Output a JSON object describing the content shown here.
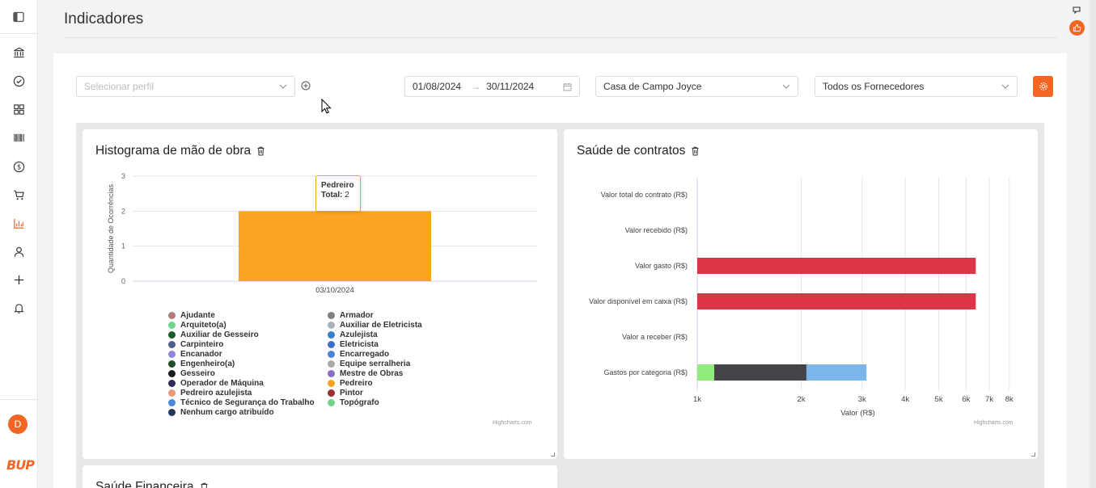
{
  "page": {
    "title": "Indicadores"
  },
  "sidebar": {
    "icons": [
      "panel-toggle-icon",
      "bank-icon",
      "check-circle-icon",
      "grid-icon",
      "barcode-icon",
      "dollar-icon",
      "cart-icon",
      "bar-chart-icon",
      "user-icon",
      "plus-icon",
      "bell-icon"
    ],
    "active": "bar-chart-icon",
    "avatar_letter": "D",
    "logo_text": "BUP"
  },
  "filters": {
    "profile_placeholder": "Selecionar perfil",
    "date_start": "01/08/2024",
    "date_end": "30/11/2024",
    "date_separator": "→",
    "project": "Casa de Campo Joyce",
    "supplier": "Todos os Fornecedores"
  },
  "colors": {
    "accent": "#f26522",
    "bar": "#f9a424",
    "red": "#dc3545",
    "dark": "#434348",
    "blue": "#7cb5ec",
    "green": "#90ed7d"
  },
  "credits": "Highcharts.com",
  "cards": {
    "histogram": {
      "title": "Histograma de mão de obra",
      "tooltip": {
        "label": "Pedreiro",
        "total_label": "Total:",
        "total_value": "2"
      }
    },
    "contracts": {
      "title": "Saúde de contratos"
    },
    "financial": {
      "title": "Saúde Financeira"
    }
  },
  "legend": [
    {
      "name": "Ajudante",
      "color": "#b07c7c"
    },
    {
      "name": "Armador",
      "color": "#7f7f7f"
    },
    {
      "name": "Arquiteto(a)",
      "color": "#6fd68b"
    },
    {
      "name": "Auxiliar de Eletricista",
      "color": "#a9b3bb"
    },
    {
      "name": "Auxiliar de Gesseiro",
      "color": "#1e5b2a"
    },
    {
      "name": "Azulejista",
      "color": "#3b7ed0"
    },
    {
      "name": "Carpinteiro",
      "color": "#4d5f8a"
    },
    {
      "name": "Eletricista",
      "color": "#3f70c9"
    },
    {
      "name": "Encanador",
      "color": "#8c86d8"
    },
    {
      "name": "Encarregado",
      "color": "#4a85d6"
    },
    {
      "name": "Engenheiro(a)",
      "color": "#1d4f24"
    },
    {
      "name": "Equipe serralheria",
      "color": "#a9a9a9"
    },
    {
      "name": "Gesseiro",
      "color": "#1c1c1c"
    },
    {
      "name": "Mestre de Obras",
      "color": "#8a6fc4"
    },
    {
      "name": "Operador de Máquina",
      "color": "#2d2d55"
    },
    {
      "name": "Pedreiro",
      "color": "#f9a424"
    },
    {
      "name": "Pedreiro azulejista",
      "color": "#e89a7a"
    },
    {
      "name": "Pintor",
      "color": "#9b2d35"
    },
    {
      "name": "Técnico de Segurança do Trabalho",
      "color": "#4a88d8"
    },
    {
      "name": "Topógrafo",
      "color": "#6fd68b"
    },
    {
      "name": "Nenhum cargo atribuído",
      "color": "#26365a"
    }
  ],
  "chart_data": [
    {
      "type": "bar",
      "title": "Histograma de mão de obra",
      "categories": [
        "03/10/2024"
      ],
      "series": [
        {
          "name": "Pedreiro",
          "values": [
            2
          ]
        }
      ],
      "ylabel": "Quantidade de Ocorrências",
      "xlabel": "",
      "ylim": [
        0,
        3
      ],
      "yticks": [
        "0",
        "1",
        "2",
        "3"
      ],
      "grid": true
    },
    {
      "type": "bar",
      "orientation": "horizontal",
      "title": "Saúde de contratos",
      "categories": [
        "Valor total do contrato (R$)",
        "Valor recebido (R$)",
        "Valor gasto (R$)",
        "Valor disponível em caixa (R$)",
        "Valor a receber (R$)",
        "Gastos por categoria (R$)"
      ],
      "xlabel": "Valor (R$)",
      "xscale": "log",
      "xlim": [
        1000,
        8500
      ],
      "xticks": [
        "1k",
        "2k",
        "3k",
        "4k",
        "5k",
        "6k",
        "7k",
        "8k"
      ],
      "grid": true,
      "bars": [
        {
          "category": "Valor gasto (R$)",
          "value": 6400,
          "color": "#dc3545"
        },
        {
          "category": "Valor disponível em caixa (R$)",
          "value": 6400,
          "color": "#dc3545"
        }
      ],
      "stacked": {
        "category": "Gastos por categoria (R$)",
        "segments": [
          {
            "from": 1000,
            "to": 1120,
            "color": "#90ed7d"
          },
          {
            "from": 1120,
            "to": 2070,
            "color": "#434348"
          },
          {
            "from": 2070,
            "to": 3090,
            "color": "#7cb5ec"
          }
        ]
      }
    }
  ]
}
